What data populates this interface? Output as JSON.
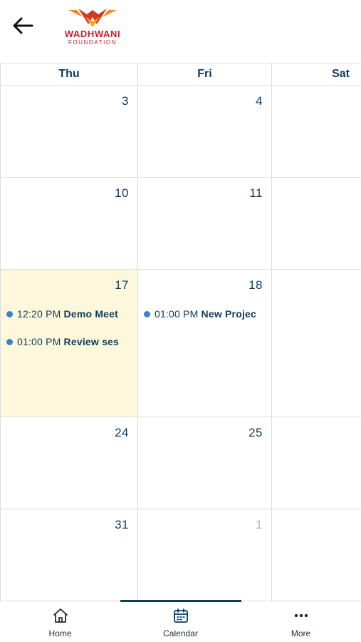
{
  "header": {
    "logo_name": "WADHWANI",
    "logo_sub": "FOUNDATION"
  },
  "calendar": {
    "days": [
      "Thu",
      "Fri",
      "Sat"
    ],
    "weeks": [
      {
        "dates": [
          "3",
          "4",
          ""
        ]
      },
      {
        "dates": [
          "10",
          "11",
          ""
        ]
      },
      {
        "dates": [
          "17",
          "18",
          ""
        ]
      },
      {
        "dates": [
          "24",
          "25",
          ""
        ]
      },
      {
        "dates": [
          "31",
          "1",
          ""
        ]
      }
    ],
    "events": {
      "thu_17": [
        {
          "time": "12:20 PM",
          "title": "Demo Meet"
        },
        {
          "time": "01:00 PM",
          "title": "Review ses"
        }
      ],
      "fri_18": [
        {
          "time": "01:00 PM",
          "title": "New Projec"
        }
      ]
    }
  },
  "bottom_nav": {
    "items": [
      {
        "label": "Home",
        "icon": "home-icon"
      },
      {
        "label": "Calendar",
        "icon": "calendar-icon",
        "active": true
      },
      {
        "label": "More",
        "icon": "more-icon"
      }
    ]
  },
  "colors": {
    "primary": "#0d3b5c",
    "today_bg": "#fdf8dc",
    "event_dot": "#3b80d0",
    "brand_red": "#c8202d",
    "brand_orange": "#f08a24"
  }
}
